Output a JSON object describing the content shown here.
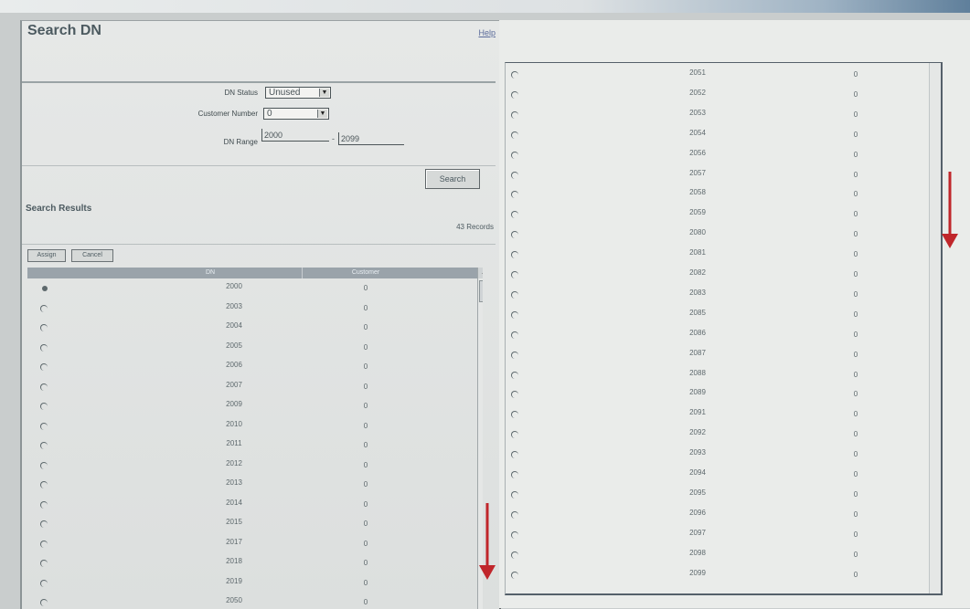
{
  "window": {
    "title": "Search DN",
    "help_link": "Help"
  },
  "form": {
    "dn_status": {
      "label": "DN Status",
      "value": "Unused"
    },
    "customer_number": {
      "label": "Customer Number",
      "value": "0"
    },
    "dn_range": {
      "label": "DN Range",
      "from": "2000",
      "separator": "-",
      "to": "2099"
    }
  },
  "search_button": "Search",
  "results": {
    "title": "Search Results",
    "record_count": "43 Records",
    "assign_label": "Assign",
    "cancel_label": "Cancel",
    "columns": [
      "DN",
      "Customer"
    ],
    "left_rows": [
      {
        "dn": "2000",
        "customer": "0"
      },
      {
        "dn": "2003",
        "customer": "0"
      },
      {
        "dn": "2004",
        "customer": "0"
      },
      {
        "dn": "2005",
        "customer": "0"
      },
      {
        "dn": "2006",
        "customer": "0"
      },
      {
        "dn": "2007",
        "customer": "0"
      },
      {
        "dn": "2009",
        "customer": "0"
      },
      {
        "dn": "2010",
        "customer": "0"
      },
      {
        "dn": "2011",
        "customer": "0"
      },
      {
        "dn": "2012",
        "customer": "0"
      },
      {
        "dn": "2013",
        "customer": "0"
      },
      {
        "dn": "2014",
        "customer": "0"
      },
      {
        "dn": "2015",
        "customer": "0"
      },
      {
        "dn": "2017",
        "customer": "0"
      },
      {
        "dn": "2018",
        "customer": "0"
      },
      {
        "dn": "2019",
        "customer": "0"
      },
      {
        "dn": "2050",
        "customer": "0"
      }
    ],
    "right_rows": [
      {
        "dn": "2051",
        "customer": "0"
      },
      {
        "dn": "2052",
        "customer": "0"
      },
      {
        "dn": "2053",
        "customer": "0"
      },
      {
        "dn": "2054",
        "customer": "0"
      },
      {
        "dn": "2056",
        "customer": "0"
      },
      {
        "dn": "2057",
        "customer": "0"
      },
      {
        "dn": "2058",
        "customer": "0"
      },
      {
        "dn": "2059",
        "customer": "0"
      },
      {
        "dn": "2080",
        "customer": "0"
      },
      {
        "dn": "2081",
        "customer": "0"
      },
      {
        "dn": "2082",
        "customer": "0"
      },
      {
        "dn": "2083",
        "customer": "0"
      },
      {
        "dn": "2085",
        "customer": "0"
      },
      {
        "dn": "2086",
        "customer": "0"
      },
      {
        "dn": "2087",
        "customer": "0"
      },
      {
        "dn": "2088",
        "customer": "0"
      },
      {
        "dn": "2089",
        "customer": "0"
      },
      {
        "dn": "2091",
        "customer": "0"
      },
      {
        "dn": "2092",
        "customer": "0"
      },
      {
        "dn": "2093",
        "customer": "0"
      },
      {
        "dn": "2094",
        "customer": "0"
      },
      {
        "dn": "2095",
        "customer": "0"
      },
      {
        "dn": "2096",
        "customer": "0"
      },
      {
        "dn": "2097",
        "customer": "0"
      },
      {
        "dn": "2098",
        "customer": "0"
      },
      {
        "dn": "2099",
        "customer": "0"
      }
    ]
  },
  "colors": {
    "arrow": "#c0262b",
    "header_bg": "#9aa3aa"
  }
}
